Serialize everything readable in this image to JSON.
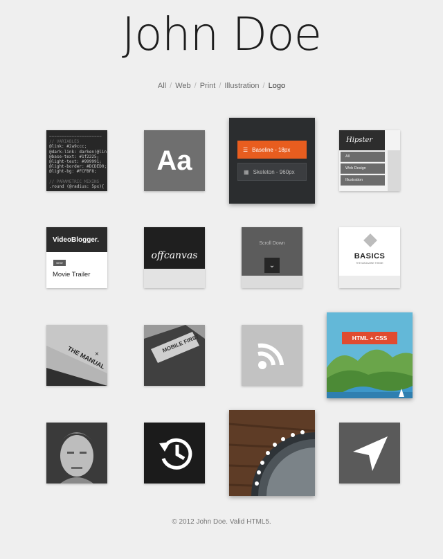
{
  "header": {
    "title": "John Doe"
  },
  "filters": {
    "items": [
      {
        "label": "All"
      },
      {
        "label": "Web"
      },
      {
        "label": "Print"
      },
      {
        "label": "Illustration"
      },
      {
        "label": "Logo",
        "active": true
      }
    ],
    "separator": "/"
  },
  "tiles": {
    "code": {
      "lines": [
        "=====================",
        "// VARIABLES",
        "@link: #2a9ccc;",
        "@dark-link: darken(@lin",
        "@base-text: #1f2225;",
        "@light-text: #999991;",
        "@light-border: #DCDED0;",
        "@light-bg: #FCFBF8;",
        "",
        "// PARAMETRIC MIXINS",
        ".round (@radius: 5px){"
      ]
    },
    "typography": {
      "label": "Aa"
    },
    "skeleton": {
      "button1": "Baseline - 18px",
      "button2": "Skeleton - 960px"
    },
    "hipster": {
      "brand": "Hipster",
      "items": [
        "All",
        "Web Design",
        "Illustration"
      ]
    },
    "videoblogger": {
      "title": "VideoBlogger.",
      "tag": "NEW",
      "subtitle": "Movie Trailer"
    },
    "offcanvas": {
      "title": "offcanvas"
    },
    "scroll": {
      "title": "Scroll Down"
    },
    "basics": {
      "title": "BASICS",
      "subtitle": "THE MAGAZINE THEME"
    },
    "manual": {
      "title": "THE MANUAL"
    },
    "mobile": {
      "title": "MOBILE FIRST"
    },
    "html": {
      "banner": "HTML + CSS"
    }
  },
  "footer": {
    "text": "© 2012 John Doe. Valid HTML5."
  },
  "colors": {
    "background": "#efefef",
    "accent": "#e85d1f",
    "banner": "#e04b30",
    "sky": "#63b8d8"
  }
}
